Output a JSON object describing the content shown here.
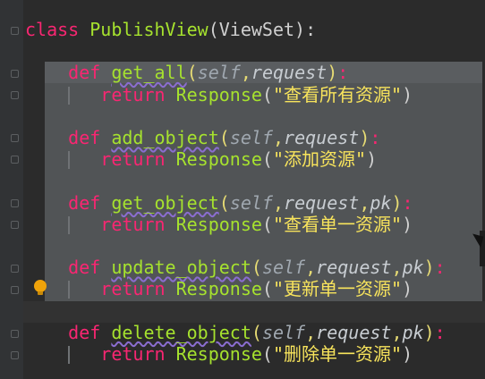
{
  "editor": {
    "lines": [
      {
        "parts": [
          {
            "t": "class ",
            "c": "kw"
          },
          {
            "t": "PublishView",
            "c": "cls"
          },
          {
            "t": "(",
            "c": "plain"
          },
          {
            "t": "ViewSet",
            "c": "plain"
          },
          {
            "t": "):",
            "c": "plain"
          }
        ]
      },
      {
        "parts": []
      },
      {
        "parts": [
          {
            "t": "    ",
            "c": "plain"
          },
          {
            "t": "def ",
            "c": "kw"
          },
          {
            "t": "get_all",
            "c": "fn"
          },
          {
            "t": "(",
            "c": "paren"
          },
          {
            "t": "self",
            "c": "self"
          },
          {
            "t": ",",
            "c": "punc"
          },
          {
            "t": "request",
            "c": "param"
          },
          {
            "t": ")",
            "c": "paren"
          },
          {
            "t": ":",
            "c": "kw"
          }
        ]
      },
      {
        "parts": [
          {
            "t": "        ",
            "c": "plain",
            "guide": true
          },
          {
            "t": "return ",
            "c": "kw"
          },
          {
            "t": "Response",
            "c": "cls"
          },
          {
            "t": "(",
            "c": "plain"
          },
          {
            "t": "\"查看所有资源\"",
            "c": "str"
          },
          {
            "t": ")",
            "c": "plain"
          }
        ]
      },
      {
        "parts": []
      },
      {
        "parts": [
          {
            "t": "    ",
            "c": "plain"
          },
          {
            "t": "def ",
            "c": "kw"
          },
          {
            "t": "add_object",
            "c": "fn"
          },
          {
            "t": "(",
            "c": "paren"
          },
          {
            "t": "self",
            "c": "self"
          },
          {
            "t": ",",
            "c": "punc"
          },
          {
            "t": "request",
            "c": "param"
          },
          {
            "t": ")",
            "c": "paren"
          },
          {
            "t": ":",
            "c": "kw"
          }
        ]
      },
      {
        "parts": [
          {
            "t": "        ",
            "c": "plain",
            "guide": true
          },
          {
            "t": "return ",
            "c": "kw"
          },
          {
            "t": "Response",
            "c": "cls"
          },
          {
            "t": "(",
            "c": "plain"
          },
          {
            "t": "\"添加资源\"",
            "c": "str"
          },
          {
            "t": ")",
            "c": "plain"
          }
        ]
      },
      {
        "parts": []
      },
      {
        "parts": [
          {
            "t": "    ",
            "c": "plain"
          },
          {
            "t": "def ",
            "c": "kw"
          },
          {
            "t": "get_object",
            "c": "fn"
          },
          {
            "t": "(",
            "c": "paren"
          },
          {
            "t": "self",
            "c": "self"
          },
          {
            "t": ",",
            "c": "punc"
          },
          {
            "t": "request",
            "c": "param"
          },
          {
            "t": ",",
            "c": "punc"
          },
          {
            "t": "pk",
            "c": "param"
          },
          {
            "t": ")",
            "c": "paren"
          },
          {
            "t": ":",
            "c": "kw"
          }
        ]
      },
      {
        "parts": [
          {
            "t": "        ",
            "c": "plain",
            "guide": true
          },
          {
            "t": "return ",
            "c": "kw"
          },
          {
            "t": "Response",
            "c": "cls"
          },
          {
            "t": "(",
            "c": "plain"
          },
          {
            "t": "\"查看单一资源\"",
            "c": "str"
          },
          {
            "t": ")",
            "c": "plain"
          }
        ]
      },
      {
        "parts": []
      },
      {
        "parts": [
          {
            "t": "    ",
            "c": "plain"
          },
          {
            "t": "def ",
            "c": "kw"
          },
          {
            "t": "update_object",
            "c": "fn"
          },
          {
            "t": "(",
            "c": "paren"
          },
          {
            "t": "self",
            "c": "self"
          },
          {
            "t": ",",
            "c": "punc"
          },
          {
            "t": "request",
            "c": "param"
          },
          {
            "t": ",",
            "c": "punc"
          },
          {
            "t": "pk",
            "c": "param"
          },
          {
            "t": ")",
            "c": "paren"
          },
          {
            "t": ":",
            "c": "kw"
          }
        ]
      },
      {
        "parts": [
          {
            "t": "        ",
            "c": "plain",
            "guide": true
          },
          {
            "t": "return ",
            "c": "kw"
          },
          {
            "t": "Response",
            "c": "cls"
          },
          {
            "t": "(",
            "c": "plain"
          },
          {
            "t": "\"更新单一资源\"",
            "c": "str"
          },
          {
            "t": ")",
            "c": "plain"
          }
        ]
      },
      {
        "parts": []
      },
      {
        "parts": [
          {
            "t": "    ",
            "c": "plain"
          },
          {
            "t": "def ",
            "c": "kw"
          },
          {
            "t": "delete_object",
            "c": "fn"
          },
          {
            "t": "(",
            "c": "paren"
          },
          {
            "t": "self",
            "c": "self"
          },
          {
            "t": ",",
            "c": "punc"
          },
          {
            "t": "request",
            "c": "param"
          },
          {
            "t": ",",
            "c": "punc"
          },
          {
            "t": "pk",
            "c": "param"
          },
          {
            "t": ")",
            "c": "paren"
          },
          {
            "t": ":",
            "c": "kw"
          }
        ]
      },
      {
        "parts": [
          {
            "t": "        ",
            "c": "plain",
            "guide": true
          },
          {
            "t": "return ",
            "c": "kw"
          },
          {
            "t": "Response",
            "c": "cls"
          },
          {
            "t": "(",
            "c": "plain"
          },
          {
            "t": "\"删除单一资源\"",
            "c": "str"
          },
          {
            "t": ")",
            "c": "plain"
          }
        ]
      }
    ]
  },
  "icons": {
    "intention": "lightbulb-icon"
  },
  "colors": {
    "background": "#2b2b2b",
    "selection": "#515456",
    "keyword": "#f92672",
    "function": "#a6e22e",
    "string": "#f8e45c"
  }
}
